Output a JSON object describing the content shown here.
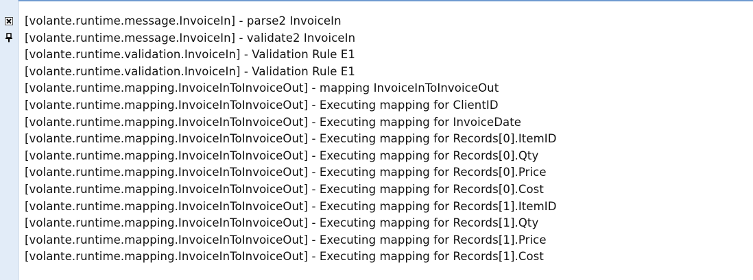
{
  "sidebar": {
    "close_icon": "close-icon",
    "pin_icon": "pin-icon"
  },
  "colors": {
    "sidebar_bg": "#e2ecf8",
    "border_blue": "#6f9ad0",
    "text": "#111111"
  },
  "log": {
    "lines": [
      "[volante.runtime.message.InvoiceIn] - parse2 InvoiceIn",
      "[volante.runtime.message.InvoiceIn] - validate2 InvoiceIn",
      "[volante.runtime.validation.InvoiceIn] - Validation Rule E1",
      "[volante.runtime.validation.InvoiceIn] - Validation Rule E1",
      "[volante.runtime.mapping.InvoiceInToInvoiceOut] - mapping InvoiceInToInvoiceOut",
      "[volante.runtime.mapping.InvoiceInToInvoiceOut] - Executing mapping for ClientID",
      "[volante.runtime.mapping.InvoiceInToInvoiceOut] - Executing mapping for InvoiceDate",
      "[volante.runtime.mapping.InvoiceInToInvoiceOut] - Executing mapping for Records[0].ItemID",
      "[volante.runtime.mapping.InvoiceInToInvoiceOut] - Executing mapping for Records[0].Qty",
      "[volante.runtime.mapping.InvoiceInToInvoiceOut] - Executing mapping for Records[0].Price",
      "[volante.runtime.mapping.InvoiceInToInvoiceOut] - Executing mapping for Records[0].Cost",
      "[volante.runtime.mapping.InvoiceInToInvoiceOut] - Executing mapping for Records[1].ItemID",
      "[volante.runtime.mapping.InvoiceInToInvoiceOut] - Executing mapping for Records[1].Qty",
      "[volante.runtime.mapping.InvoiceInToInvoiceOut] - Executing mapping for Records[1].Price",
      "[volante.runtime.mapping.InvoiceInToInvoiceOut] - Executing mapping for Records[1].Cost"
    ]
  }
}
